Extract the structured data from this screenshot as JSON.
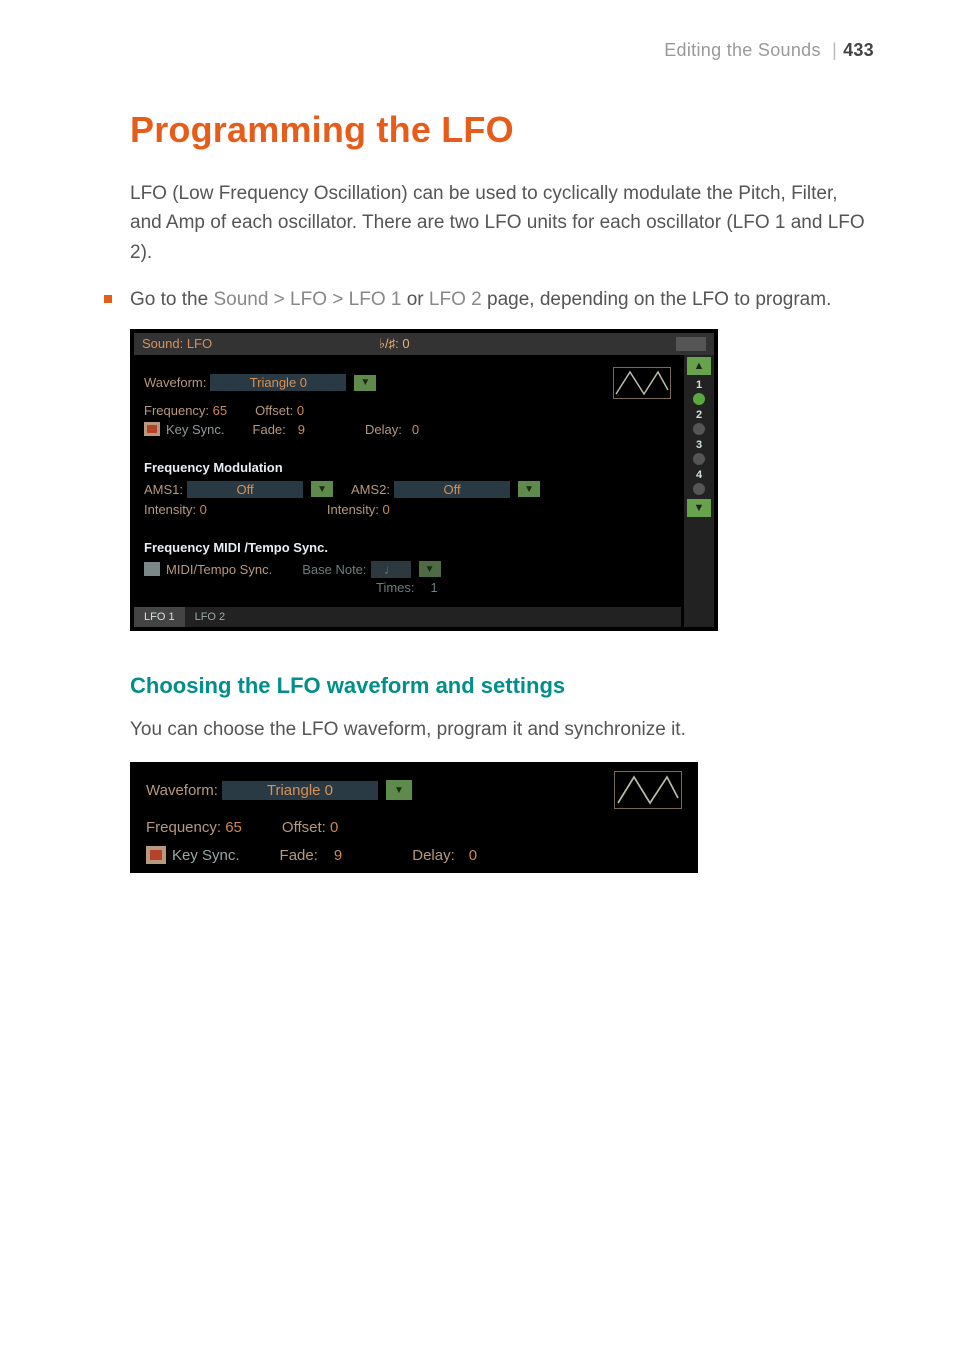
{
  "header": {
    "section": "Editing the Sounds",
    "divider": "|",
    "page": "433"
  },
  "title": "Programming the LFO",
  "intro": "LFO (Low Frequency Oscillation) can be used to cyclically modulate the Pitch, Filter, and Amp of each oscillator. There are two LFO units for each oscillator (LFO 1 and LFO 2).",
  "bullet": {
    "pre": "Go to the ",
    "nav": "Sound > LFO > LFO 1",
    "mid": " or ",
    "nav2": "LFO 2",
    "post": " page, depending on the LFO to program."
  },
  "shot1": {
    "titlebar": {
      "left": "Sound: LFO",
      "center": "♭/♯: 0"
    },
    "waveform": {
      "label": "Waveform:",
      "value": "Triangle 0",
      "freq_label": "Frequency:",
      "freq_value": "65",
      "offset_label": "Offset:",
      "offset_value": "0",
      "keysync_label": "Key Sync.",
      "fade_label": "Fade:",
      "fade_value": "9",
      "delay_label": "Delay:",
      "delay_value": "0"
    },
    "freqmod": {
      "title": "Frequency Modulation",
      "ams1_label": "AMS1:",
      "ams1_value": "Off",
      "ams2_label": "AMS2:",
      "ams2_value": "Off",
      "int1_label": "Intensity:",
      "int1_value": "0",
      "int2_label": "Intensity:",
      "int2_value": "0"
    },
    "tempo": {
      "title": "Frequency MIDI /Tempo Sync.",
      "chk_label": "MIDI/Tempo Sync.",
      "base_label": "Base Note:",
      "base_value": "♩",
      "times_label": "Times:",
      "times_value": "1"
    },
    "tabs": {
      "t1": "LFO 1",
      "t2": "LFO 2"
    },
    "side": {
      "n1": "1",
      "n2": "2",
      "n3": "3",
      "n4": "4"
    }
  },
  "subheading": "Choosing the LFO waveform and settings",
  "subtext": "You can choose the LFO waveform, program it and synchronize it.",
  "shot2": {
    "waveform_label": "Waveform:",
    "waveform_value": "Triangle 0",
    "freq_label": "Frequency:",
    "freq_value": "65",
    "offset_label": "Offset:",
    "offset_value": "0",
    "keysync_label": "Key Sync.",
    "fade_label": "Fade:",
    "fade_value": "9",
    "delay_label": "Delay:",
    "delay_value": "0"
  }
}
